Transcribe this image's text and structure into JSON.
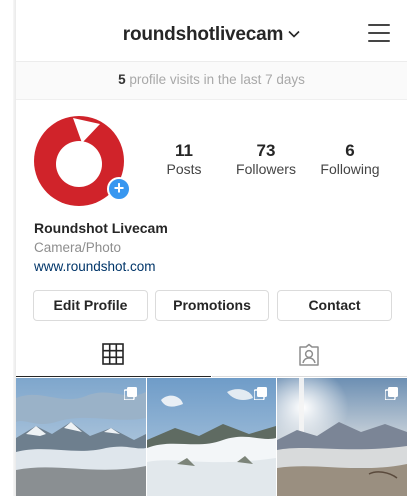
{
  "header": {
    "username": "roundshotlivecam",
    "chevron_icon": "chevron-down-icon",
    "menu_icon": "hamburger-menu-icon"
  },
  "insights": {
    "count": "5",
    "text": "profile visits in the last 7 days"
  },
  "profile": {
    "avatar_icon": "roundshot-logo",
    "brand_color": "#d0232a",
    "add_badge": "+",
    "stats": [
      {
        "value": "11",
        "label": "Posts"
      },
      {
        "value": "73",
        "label": "Followers"
      },
      {
        "value": "6",
        "label": "Following"
      }
    ],
    "name": "Roundshot Livecam",
    "category": "Camera/Photo",
    "website": "www.roundshot.com"
  },
  "actions": {
    "edit": "Edit Profile",
    "promotions": "Promotions",
    "contact": "Contact"
  },
  "tabs": [
    {
      "icon": "grid-icon",
      "active": true
    },
    {
      "icon": "tagged-person-icon",
      "active": false
    }
  ],
  "posts": [
    {
      "scene": "alpine-panorama-clouds",
      "multi_icon": "carousel-icon"
    },
    {
      "scene": "snowy-hills-sunny",
      "multi_icon": "carousel-icon"
    },
    {
      "scene": "mountain-lake-sunset",
      "multi_icon": "carousel-icon"
    }
  ]
}
